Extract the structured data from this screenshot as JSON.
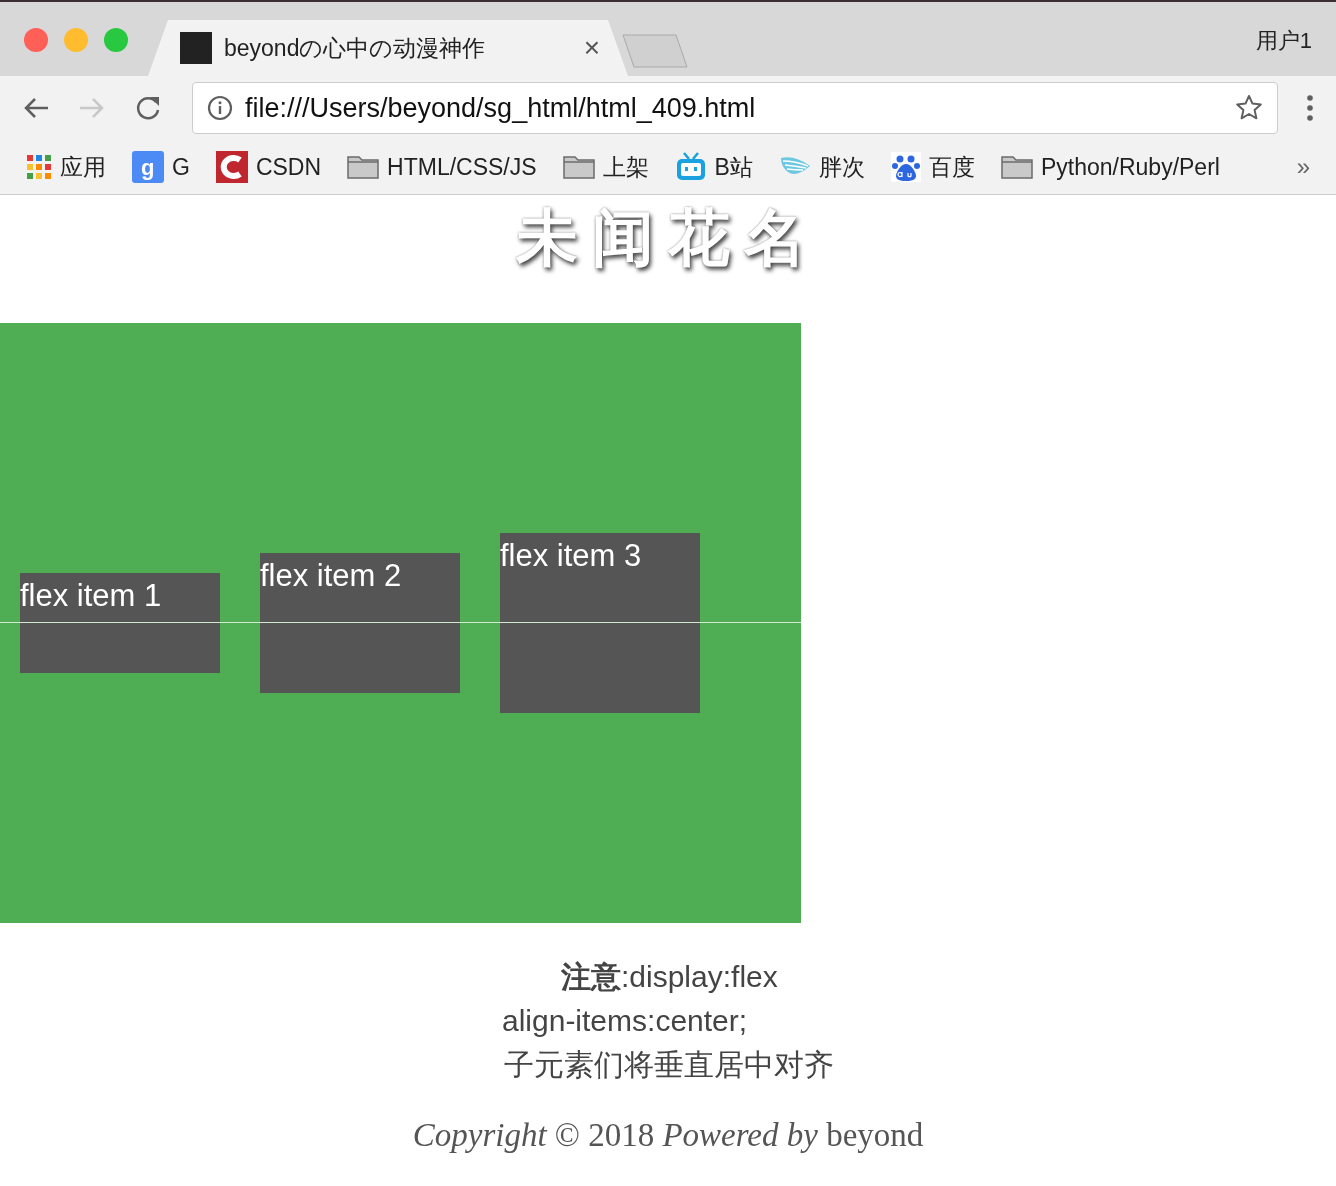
{
  "window": {
    "user": "用户1"
  },
  "tabs": [
    {
      "title": "beyondの心中の动漫神作",
      "close": "×",
      "selected": true
    }
  ],
  "address_bar": {
    "url": "file:///Users/beyond/sg_html/html_409.html"
  },
  "bookmarks": [
    {
      "kind": "apps",
      "label": "应用"
    },
    {
      "kind": "g",
      "label": "G"
    },
    {
      "kind": "csdn",
      "label": "CSDN"
    },
    {
      "kind": "folder",
      "label": "HTML/CSS/JS"
    },
    {
      "kind": "folder",
      "label": "上架"
    },
    {
      "kind": "bili",
      "label": "B站"
    },
    {
      "kind": "wave",
      "label": "胖次"
    },
    {
      "kind": "baidu",
      "label": "百度"
    },
    {
      "kind": "folder",
      "label": "Python/Ruby/Perl"
    }
  ],
  "bookmarks_more": "»",
  "page": {
    "title": "未闻花名",
    "flex_items": [
      "flex item 1",
      "flex item 2",
      "flex item 3"
    ],
    "notes": [
      "**注意**:display:flex",
      "align-items:center;",
      "子元素们将垂直居中对齐"
    ],
    "footer": "*Copyright* © 2018 *Powered by* beyond"
  }
}
